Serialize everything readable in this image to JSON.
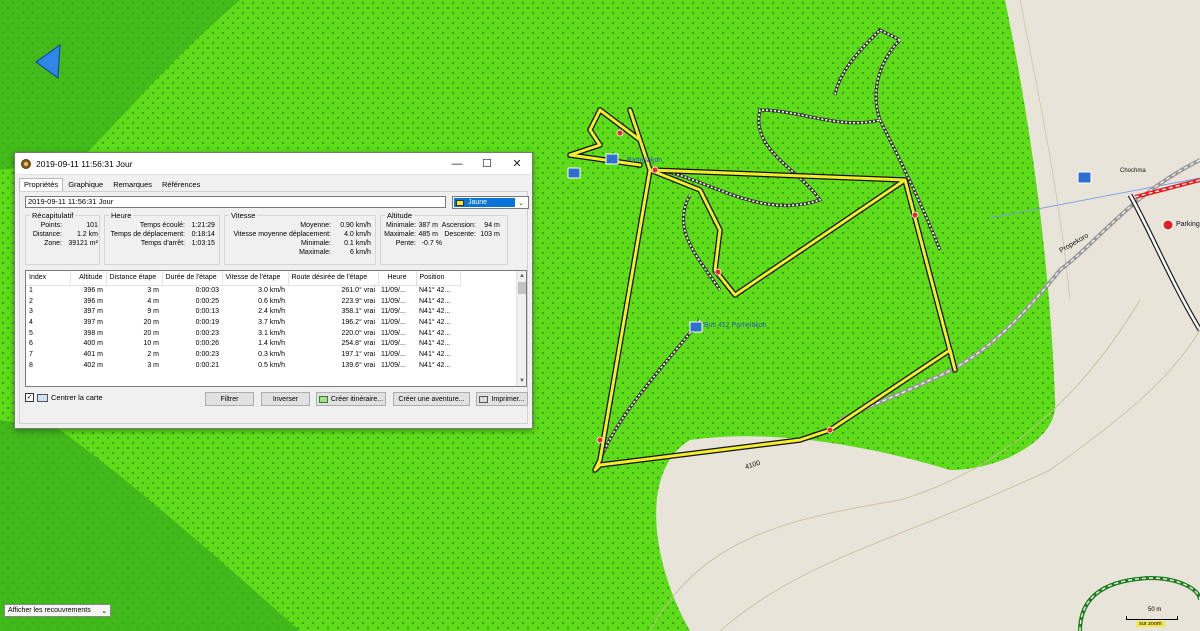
{
  "map": {
    "labels": [
      "Pamelakon",
      "Bus 412 Pamelakon",
      "Parking",
      "Chochma",
      "4100",
      "Propekoro"
    ],
    "colors": {
      "forest": "#5edc1a",
      "open": "#e9e4da",
      "track": "#f4ee2a"
    }
  },
  "window": {
    "title": "2019-09-11 11:56:31 Jour",
    "minimize": "—",
    "maximize": "☐",
    "close": "✕"
  },
  "tabs": [
    "Propriétés",
    "Graphique",
    "Remarques",
    "Références"
  ],
  "name_field": "2019-09-11 11:56:31 Jour",
  "color_select": "Jaune",
  "recap": {
    "title": "Récapitulatif",
    "rows": [
      {
        "k": "Points:",
        "v": "101"
      },
      {
        "k": "Distance:",
        "v": "1.2 km"
      },
      {
        "k": "Zone:",
        "v": "39121 m²"
      }
    ]
  },
  "heure": {
    "title": "Heure",
    "rows": [
      {
        "k": "Temps écoulé:",
        "v": "1:21:29"
      },
      {
        "k": "Temps de déplacement:",
        "v": "0:18:14"
      },
      {
        "k": "Temps d'arrêt:",
        "v": "1:03:15"
      }
    ]
  },
  "vitesse": {
    "title": "Vitesse",
    "rows": [
      {
        "k": "Moyenne:",
        "v": "0.90 km/h"
      },
      {
        "k": "Vitesse moyenne déplacement:",
        "v": "4.0 km/h"
      },
      {
        "k": "Minimale:",
        "v": "0.1 km/h"
      },
      {
        "k": "Maximale:",
        "v": "6 km/h"
      }
    ]
  },
  "altitude": {
    "title": "Altitude",
    "rows": [
      {
        "k": "Minimale:",
        "v": "387 m",
        "k2": "Ascension:",
        "v2": "94 m"
      },
      {
        "k": "Maximale:",
        "v": "485 m",
        "k2": "Descente:",
        "v2": "103 m"
      },
      {
        "k": "Pente:",
        "v": "-0.7 %",
        "k2": "",
        "v2": ""
      }
    ]
  },
  "table": {
    "columns": [
      "Index",
      "Altitude",
      "Distance étape",
      "Durée de l'étape",
      "Vitesse de l'étape",
      "Route désirée de l'étape",
      "Heure",
      "Position"
    ],
    "rows": [
      [
        "1",
        "396 m",
        "3 m",
        "0:00:03",
        "3.0 km/h",
        "261.0° vrai",
        "11/09/...",
        "N41° 42..."
      ],
      [
        "2",
        "396 m",
        "4 m",
        "0:00:25",
        "0.6 km/h",
        "223.9° vrai",
        "11/09/...",
        "N41° 42..."
      ],
      [
        "3",
        "397 m",
        "9 m",
        "0:00:13",
        "2.4 km/h",
        "358.1° vrai",
        "11/09/...",
        "N41° 42..."
      ],
      [
        "4",
        "397 m",
        "20 m",
        "0:00:19",
        "3.7 km/h",
        "196.2° vrai",
        "11/09/...",
        "N41° 42..."
      ],
      [
        "5",
        "398 m",
        "20 m",
        "0:00:23",
        "3.1 km/h",
        "220.0° vrai",
        "11/09/...",
        "N41° 42..."
      ],
      [
        "6",
        "400 m",
        "10 m",
        "0:00:26",
        "1.4 km/h",
        "254.8° vrai",
        "11/09/...",
        "N41° 42..."
      ],
      [
        "7",
        "401 m",
        "2 m",
        "0:00:23",
        "0.3 km/h",
        "197.1° vrai",
        "11/09/...",
        "N41° 42..."
      ],
      [
        "8",
        "402 m",
        "3 m",
        "0:00:21",
        "0.5 km/h",
        "139.6° vrai",
        "11/09/...",
        "N41° 42..."
      ]
    ]
  },
  "center_map": {
    "label": "Centrer la carte",
    "checked": "✓"
  },
  "buttons": {
    "filter": "Filtrer",
    "reverse": "Inverser",
    "create_route": "Créer itinéraire...",
    "create_adventure": "Créer une aventure...",
    "print": "Imprimer..."
  },
  "overlay_select": "Afficher les recouvrements",
  "scale": {
    "label": "50 m",
    "zoom": "sur zoom"
  }
}
